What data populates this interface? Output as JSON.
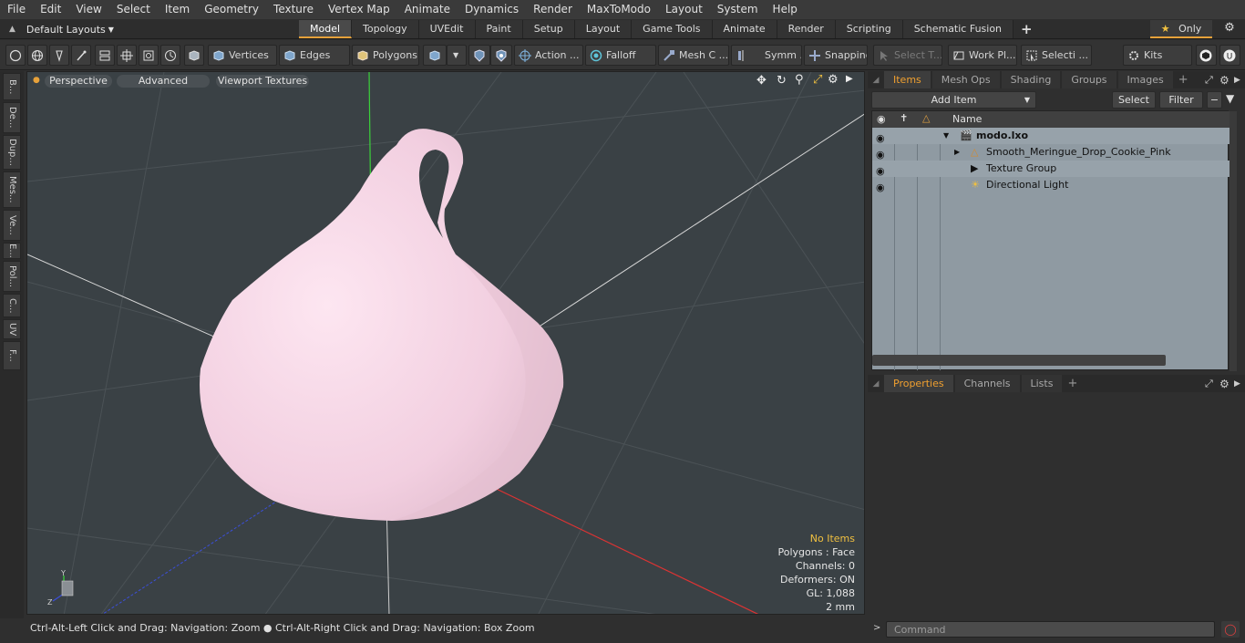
{
  "menu": [
    "File",
    "Edit",
    "View",
    "Select",
    "Item",
    "Geometry",
    "Texture",
    "Vertex Map",
    "Animate",
    "Dynamics",
    "Render",
    "MaxToModo",
    "Layout",
    "System",
    "Help"
  ],
  "layouts_label": "Default Layouts",
  "tabs": [
    "Model",
    "Topology",
    "UVEdit",
    "Paint",
    "Setup",
    "Layout",
    "Game Tools",
    "Animate",
    "Render",
    "Scripting",
    "Schematic Fusion"
  ],
  "active_tab": "Model",
  "only_label": "Only",
  "toolbar": {
    "vertices": "Vertices",
    "edges": "Edges",
    "polygons": "Polygons",
    "action": "Action ...",
    "falloff": "Falloff",
    "mesh": "Mesh C ...",
    "symm": "Symm ...",
    "snapping": "Snapping",
    "select_t": "Select T...",
    "work_pl": "Work Pl...",
    "selecti": "Selecti ...",
    "kits": "Kits"
  },
  "left_tabs": [
    "B...",
    "De...",
    "Dup...",
    "Mes...",
    "Ve...",
    "E...",
    "Pol...",
    "C...",
    "UV",
    "F..."
  ],
  "viewport": {
    "perspective": "Perspective",
    "advanced": "Advanced",
    "textures": "Viewport Textures",
    "info": [
      "No Items",
      "Polygons : Face",
      "Channels: 0",
      "Deformers: ON",
      "GL: 1,088",
      "2 mm"
    ]
  },
  "status_text": "Ctrl-Alt-Left Click and Drag: Navigation: Zoom ● Ctrl-Alt-Right Click and Drag: Navigation: Box Zoom",
  "items_panel": {
    "tabs": [
      "Items",
      "Mesh Ops",
      "Shading",
      "Groups",
      "Images"
    ],
    "add_item": "Add Item",
    "select": "Select",
    "filter": "Filter",
    "name_col": "Name",
    "tree": [
      "modo.lxo",
      "Smooth_Meringue_Drop_Cookie_Pink",
      "Texture Group",
      "Directional Light"
    ]
  },
  "props_panel": {
    "tabs": [
      "Properties",
      "Channels",
      "Lists"
    ]
  },
  "command_placeholder": "Command",
  "colors": {
    "accent": "#e6a13a",
    "object": "#f4d4e3",
    "viewport_bg": "#3a4145"
  }
}
